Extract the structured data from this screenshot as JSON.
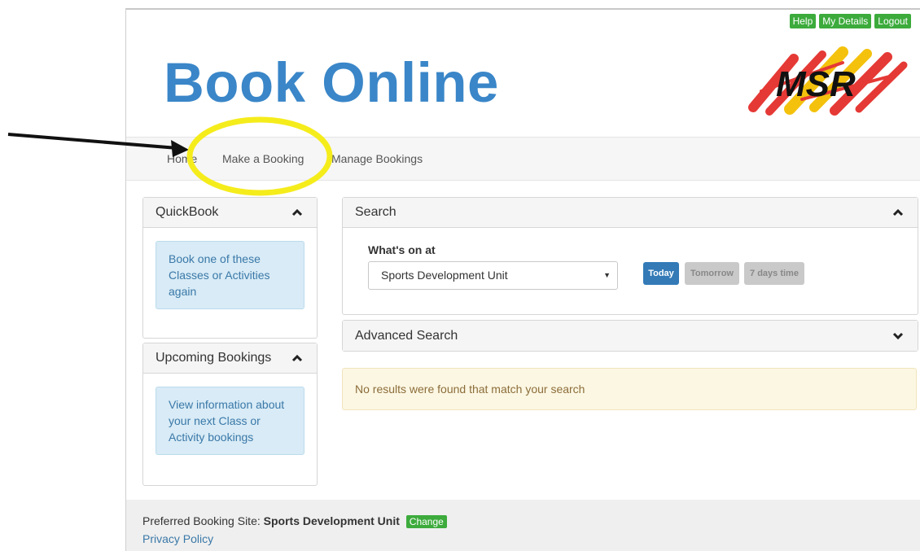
{
  "header": {
    "title": "Book Online",
    "logo_text": "MSR",
    "top_links": [
      "Help",
      "My Details",
      "Logout"
    ]
  },
  "nav": {
    "home": "Home",
    "make_booking": "Make a Booking",
    "manage_bookings": "Manage Bookings"
  },
  "quickbook": {
    "title": "QuickBook",
    "text": "Book one of these Classes or Activities again"
  },
  "upcoming": {
    "title": "Upcoming Bookings",
    "text": "View information about your next Class or Activity bookings"
  },
  "search": {
    "title": "Search",
    "whats_on_label": "What's on at",
    "selected_site": "Sports Development Unit",
    "buttons": [
      "Today",
      "Tomorrow",
      "7 days time"
    ]
  },
  "advanced_search": {
    "title": "Advanced Search"
  },
  "results": {
    "message": "No results were found that match your search"
  },
  "footer": {
    "preferred_label": "Preferred Booking Site:",
    "preferred_site": "Sports Development Unit",
    "change_label": "Change",
    "privacy_label": "Privacy Policy"
  },
  "colors": {
    "brand_blue": "#3a86c8",
    "green": "#3cab3c",
    "primary_button": "#337ab7",
    "annotation_highlight": "#f5ec1c"
  }
}
